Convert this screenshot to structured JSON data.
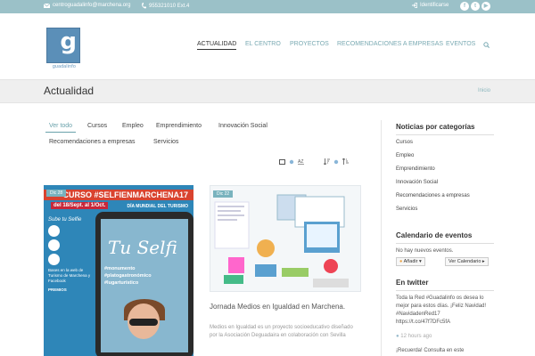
{
  "topbar": {
    "email": "centroguadalinfo@marchena.org",
    "phone": "955321010 Ext.4",
    "login": "Identificarse",
    "social_icons": [
      "facebook-icon",
      "twitter-icon",
      "youtube-icon"
    ]
  },
  "logo": {
    "letter": "g",
    "text": "guadalinfo"
  },
  "nav": {
    "items": [
      "ACTUALIDAD",
      "EL CENTRO",
      "PROYECTOS",
      "RECOMENDACIONES A EMPRESAS",
      "EVENTOS"
    ],
    "active": "ACTUALIDAD"
  },
  "page": {
    "title": "Actualidad",
    "breadcrumb": "Inicio"
  },
  "filters": [
    "Ver todo",
    "Cursos",
    "Empleo",
    "Emprendimiento",
    "Innovación Social",
    "Recomendaciones a empresas",
    "Servicios"
  ],
  "cards": {
    "card1": {
      "date": "Dic 28",
      "banner": "CURSO #SELFIENMARCHENA17",
      "dates": "del 18/Sept. al 1/Oct.",
      "dia": "DÍA MUNDIAL DEL TURISMO",
      "side": [
        "Sube tu Selfie",
        "Bases en la web de Turismo de Marchena y Facebook",
        "PREMIOS"
      ],
      "phone_title": "Tu Selfi",
      "phone_tags": [
        "#monumento",
        "#platogastronómico",
        "#lugarturístico"
      ]
    },
    "card2": {
      "date": "Dic 22",
      "title": "Jornada Medios en Igualdad en Marchena.",
      "text": "Medios en Igualdad es un proyecto socioeducativo diseñado por la Asociación Deguadaira en colaboración con Sevilla"
    }
  },
  "sidebar": {
    "categories_title": "Noticias por categorías",
    "categories": [
      "Cursos",
      "Empleo",
      "Emprendimiento",
      "Innovación Social",
      "Recomendaciones a empresas",
      "Servicios"
    ],
    "calendar_title": "Calendario de eventos",
    "calendar_text": "No hay nuevos eventos.",
    "add_button": "Añadir",
    "view_button": "Ver Calendario",
    "twitter_title": "En twitter",
    "tweet": "Toda la Red #Guadalinfo os desea lo mejor para estos días. ¡Feliz Navidad! #NavidadenRed17 https://t.co/47f7DFc5fA",
    "tweet_time": "12 hours ago",
    "tweet2": "¡Recuerda! Consulta en este"
  },
  "colors": {
    "accent": "#6aa2ab",
    "topbar": "#9bc1c8",
    "nav": "#7aaab3"
  }
}
